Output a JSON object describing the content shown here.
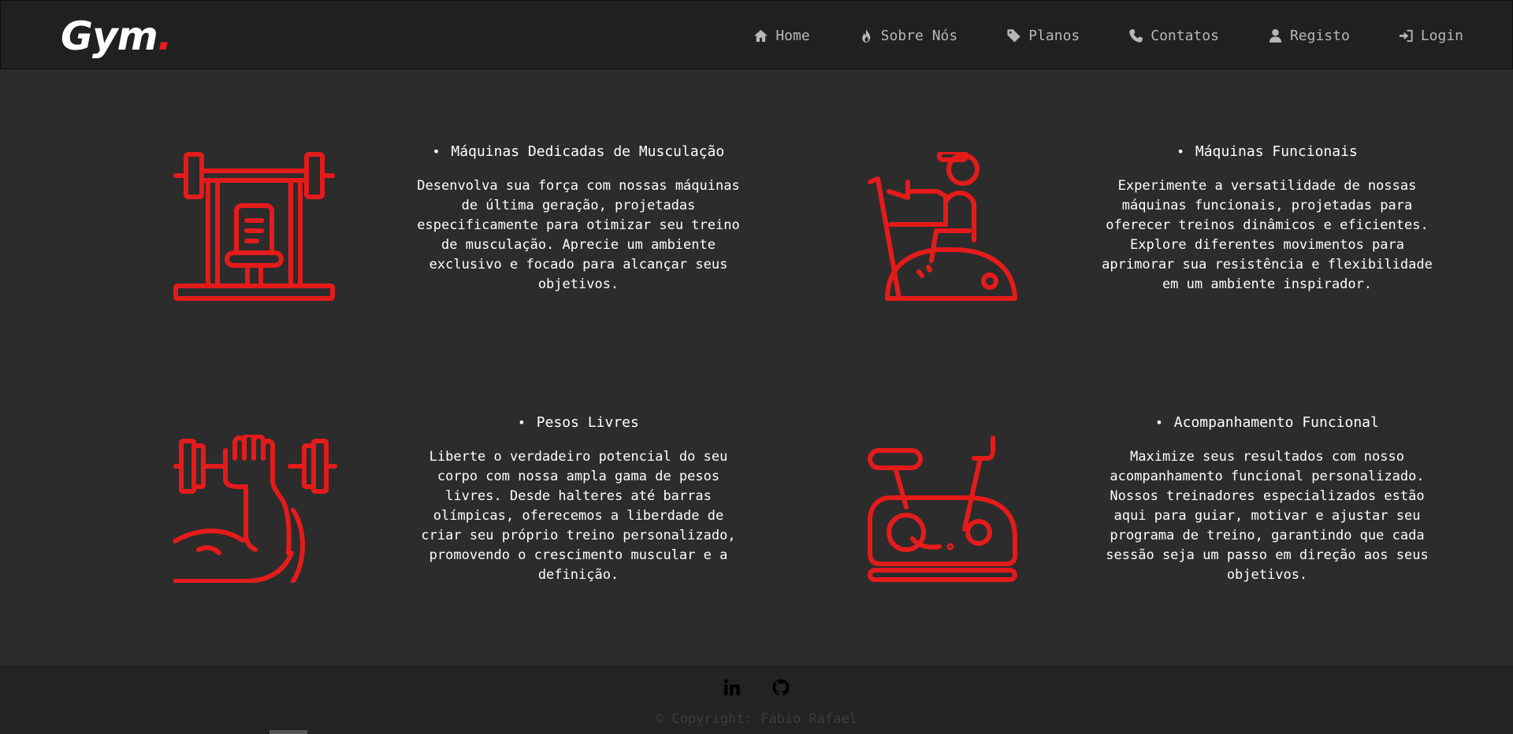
{
  "brand": {
    "name": "Gym",
    "dot": ".",
    "accent": "#e41b1b"
  },
  "nav": [
    {
      "label": "Home",
      "icon": "home-icon"
    },
    {
      "label": "Sobre Nós",
      "icon": "fire-icon"
    },
    {
      "label": "Planos",
      "icon": "tag-icon"
    },
    {
      "label": "Contatos",
      "icon": "phone-icon"
    },
    {
      "label": "Registo",
      "icon": "user-icon"
    },
    {
      "label": "Login",
      "icon": "login-icon"
    }
  ],
  "cards": [
    {
      "title": "Máquinas Dedicadas de Musculação",
      "desc": "Desenvolva sua força com nossas máquinas de última geração, projetadas especificamente para otimizar seu treino de musculação. Aprecie um ambiente exclusivo e focado para alcançar seus objetivos.",
      "icon": "bench-press-icon"
    },
    {
      "title": "Máquinas Funcionais",
      "desc": "Experimente a versatilidade de nossas máquinas funcionais, projetadas para oferecer treinos dinâmicos e eficientes. Explore diferentes movimentos para aprimorar sua resistência e flexibilidade em um ambiente inspirador.",
      "icon": "exercise-bike-rider-icon"
    },
    {
      "title": "Pesos Livres",
      "desc": "Liberte o verdadeiro potencial do seu corpo com nossa ampla gama de pesos livres. Desde halteres até barras olímpicas, oferecemos a liberdade de criar seu próprio treino personalizado, promovendo o crescimento muscular e a definição.",
      "icon": "dumbbell-arm-icon"
    },
    {
      "title": "Acompanhamento Funcional",
      "desc": "Maximize seus resultados com nosso acompanhamento funcional personalizado. Nossos treinadores especializados estão aqui para guiar, motivar e ajustar seu programa de treino, garantindo que cada sessão seja um passo em direção aos seus objetivos.",
      "icon": "stationary-bike-icon"
    }
  ],
  "bullet": "•",
  "footer": {
    "socials": [
      "linkedin-icon",
      "github-icon"
    ],
    "copyright": "© Copyright: Fábio Rafael"
  }
}
